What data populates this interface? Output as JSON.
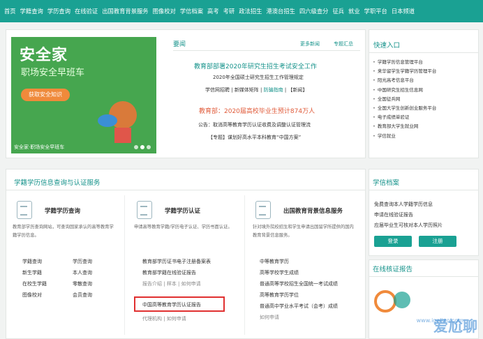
{
  "nav": [
    "首页",
    "学籍查询",
    "学历查询",
    "在线验证",
    "出国教育背景服务",
    "图像校对",
    "学信档案",
    "高考",
    "考研",
    "政法招生",
    "港澳台招生",
    "四六级查分",
    "征兵",
    "就业",
    "学职平台",
    "日本频道"
  ],
  "banner": {
    "title": "安全家",
    "subtitle": "职场安全早班车",
    "button": "获取安全知识",
    "caption": "安全家·职场安全早班车"
  },
  "news": {
    "title": "要闻",
    "more": "更多新闻",
    "special": "专题汇总",
    "headline1": "教育部部署2020年研究生招生考试安全工作",
    "line1": "2020年全国硕士研究生招生工作管理规定",
    "line2": [
      "学信网招聘",
      "新媒体矩阵",
      "防骗指南",
      "新闻"
    ],
    "headline2": "教育部：2020届高校毕业生预计874万人",
    "line3": "公告：取消高等教育学历认证收费及调整认证管理流",
    "line4": "【专题】谋划好高水平本科教育“中国方案”"
  },
  "quick": {
    "title": "快速入口",
    "items": [
      "学籍学历信息管理平台",
      "来华留学生学籍学历管理平台",
      "阳光高考信息平台",
      "中国研究生招生信息网",
      "全国征兵网",
      "全国大学生创新创业服务平台",
      "电子成绩单验证",
      "教育部大学生就业网",
      "学信就业"
    ]
  },
  "services": {
    "title": "学籍学历信息查询与认证服务",
    "s1": {
      "title": "学籍学历查询",
      "desc": "教育部学历查询网站，可查询国家承认的高等教育学籍学历信息。",
      "links": [
        "学籍查询",
        "学历查询",
        "新生学籍",
        "本人查询",
        "在校生学籍",
        "零散查询",
        "图像校对",
        "会员查询"
      ]
    },
    "s2": {
      "title": "学籍学历认证",
      "desc": "申请高等教育学籍/学历电子认证、学历书面认证。",
      "links": [
        "教育部学历证书电子注册备案表",
        "教育部学籍在线验证报告"
      ],
      "meta1": [
        "报告介绍",
        "样本",
        "如何申请"
      ],
      "highlight": "中国高等教育学历认证报告",
      "meta2": [
        "代理机构",
        "如何申请"
      ]
    },
    "s3": {
      "title": "出国教育背景信息服务",
      "desc": "针对境外院校招生和学生申请出国留学所提供的国内教育背景信息服务。",
      "links": [
        "中等教育学历",
        "高等学校学生成绩",
        "普通高等学校招生全国统一考试成绩",
        "高等教育学历学位",
        "普通高中学业水平考试（会考）成绩"
      ],
      "meta": "如何申请"
    }
  },
  "archive": {
    "title": "学信档案",
    "items": [
      "免费查询本人学籍学历信息",
      "申请在线验证报告",
      "应届毕业生可核对本人学历照片"
    ],
    "login": "登录",
    "register": "注册"
  },
  "verify": {
    "title": "在线核证报告"
  },
  "watermark": {
    "text": "爱尬聊",
    "url": "www.igaliao.com"
  }
}
